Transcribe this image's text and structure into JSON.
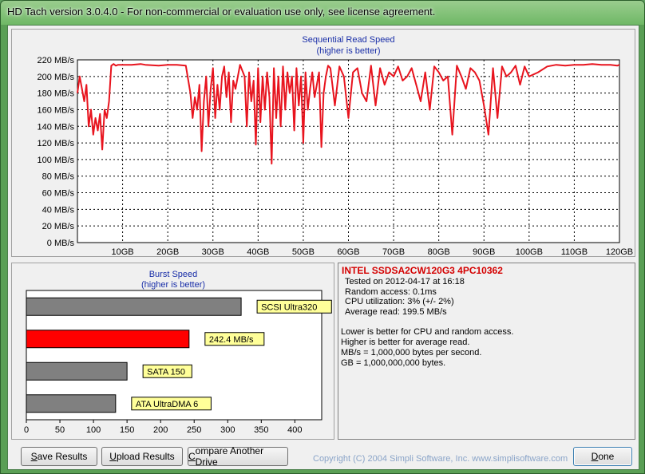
{
  "window": {
    "title": "HD Tach version 3.0.4.0  - For non-commercial or evaluation use only, see license agreement."
  },
  "seq_chart": {
    "title": "Sequential Read Speed",
    "subtitle": "(higher is better)",
    "y_ticks": [
      "0 MB/s",
      "20 MB/s",
      "40 MB/s",
      "60 MB/s",
      "80 MB/s",
      "100 MB/s",
      "120 MB/s",
      "140 MB/s",
      "160 MB/s",
      "180 MB/s",
      "200 MB/s",
      "220 MB/s"
    ],
    "x_ticks": [
      "10GB",
      "20GB",
      "30GB",
      "40GB",
      "50GB",
      "60GB",
      "70GB",
      "80GB",
      "90GB",
      "100GB",
      "110GB",
      "120GB"
    ],
    "line_color": "#e8141e"
  },
  "chart_data": [
    {
      "type": "line",
      "title": "Sequential Read Speed",
      "subtitle": "(higher is better)",
      "xlabel": "",
      "ylabel": "",
      "xlim": [
        0,
        120
      ],
      "ylim": [
        0,
        220
      ],
      "grid": true,
      "x": [
        0,
        0.5,
        1,
        1.5,
        2,
        2.5,
        3,
        3.5,
        4,
        4.5,
        5,
        5.5,
        6,
        6.5,
        7,
        7.5,
        8,
        8.5,
        9,
        10,
        12,
        14,
        15,
        18,
        20,
        22,
        24,
        25,
        25.5,
        26,
        26.5,
        27,
        27.5,
        28,
        28.5,
        29,
        29.5,
        30,
        30.5,
        31,
        31.5,
        32,
        32.5,
        33,
        33.5,
        34,
        34.5,
        35,
        36,
        37,
        37.5,
        38,
        38.5,
        39,
        39.5,
        40,
        40.5,
        41,
        41.5,
        42,
        42.5,
        43,
        43.5,
        44,
        44.5,
        45,
        45.5,
        46,
        46.5,
        47,
        47.5,
        48,
        48.5,
        49,
        49.5,
        50,
        50.5,
        51,
        51.5,
        52,
        52.5,
        53,
        53.5,
        54,
        54.5,
        55,
        55.5,
        56,
        57,
        58,
        59,
        60,
        61,
        62,
        63,
        64,
        65,
        66,
        67,
        68,
        69,
        70,
        71,
        72,
        73,
        74,
        75,
        76,
        77,
        78,
        79,
        80,
        81,
        82,
        83,
        84,
        85,
        86,
        87,
        88,
        89,
        90,
        91,
        92,
        93,
        94,
        95,
        96,
        97,
        98,
        99,
        100,
        102,
        104,
        106,
        108,
        110,
        112,
        114,
        116,
        118,
        119.5,
        120
      ],
      "series": [
        {
          "name": "",
          "values": [
            180,
            200,
            185,
            170,
            190,
            140,
            160,
            130,
            150,
            135,
            155,
            112,
            160,
            150,
            170,
            213,
            215,
            213,
            214,
            214,
            214,
            215,
            214,
            213,
            214,
            214,
            213,
            180,
            150,
            175,
            160,
            190,
            110,
            170,
            200,
            140,
            185,
            210,
            150,
            190,
            160,
            200,
            212,
            175,
            205,
            145,
            195,
            185,
            214,
            200,
            140,
            205,
            170,
            195,
            118,
            210,
            145,
            200,
            160,
            205,
            175,
            95,
            210,
            150,
            200,
            140,
            212,
            160,
            205,
            180,
            200,
            135,
            210,
            165,
            200,
            120,
            205,
            160,
            185,
            205,
            175,
            190,
            205,
            115,
            180,
            200,
            213,
            210,
            165,
            212,
            200,
            150,
            205,
            210,
            180,
            170,
            213,
            165,
            210,
            190,
            205,
            200,
            212,
            195,
            200,
            210,
            190,
            170,
            205,
            160,
            212,
            205,
            195,
            200,
            130,
            213,
            200,
            185,
            210,
            205,
            195,
            165,
            130,
            210,
            150,
            212,
            200,
            205,
            213,
            190,
            212,
            200,
            205,
            212,
            214,
            213,
            214,
            214,
            215,
            214,
            214,
            213,
            214,
            212,
            180
          ]
        }
      ]
    },
    {
      "type": "bar",
      "title": "Burst Speed",
      "subtitle": "(higher is better)",
      "orientation": "horizontal",
      "categories": [
        "SCSI Ultra320",
        "242.4 MB/s",
        "SATA 150",
        "ATA UltraDMA 6"
      ],
      "values": [
        320,
        242.4,
        150,
        133
      ],
      "xlim": [
        0,
        440
      ],
      "x_ticks": [
        "0",
        "50",
        "100",
        "150",
        "200",
        "250",
        "300",
        "350",
        "400"
      ],
      "colors": [
        "#808080",
        "#ff0000",
        "#808080",
        "#808080"
      ],
      "label_bg": "#ffff99"
    }
  ],
  "burst_chart": {
    "title": "Burst Speed",
    "subtitle": "(higher is better)",
    "labels": [
      "SCSI Ultra320",
      "242.4 MB/s",
      "SATA 150",
      "ATA UltraDMA 6"
    ]
  },
  "info": {
    "drive": "INTEL SSDSA2CW120G3 4PC10362",
    "tested": "Tested on 2012-04-17 at 16:18",
    "random_access": "Random access: 0.1ms",
    "cpu": "CPU utilization: 3% (+/- 2%)",
    "avg_read": "Average read: 199.5 MB/s",
    "notes": [
      "Lower is better for CPU and random access.",
      "Higher is better for average read.",
      "MB/s = 1,000,000 bytes per second.",
      "GB = 1,000,000,000 bytes."
    ]
  },
  "buttons": {
    "save_u": "S",
    "save_rest": "ave Results",
    "upload_u": "U",
    "upload_rest": "pload Results",
    "compare_u": "C",
    "compare_rest": "ompare Another Drive",
    "done_u": "D",
    "done_rest": "one"
  },
  "copyright": "Copyright (C) 2004 Simpli Software, Inc. www.simplisoftware.com"
}
